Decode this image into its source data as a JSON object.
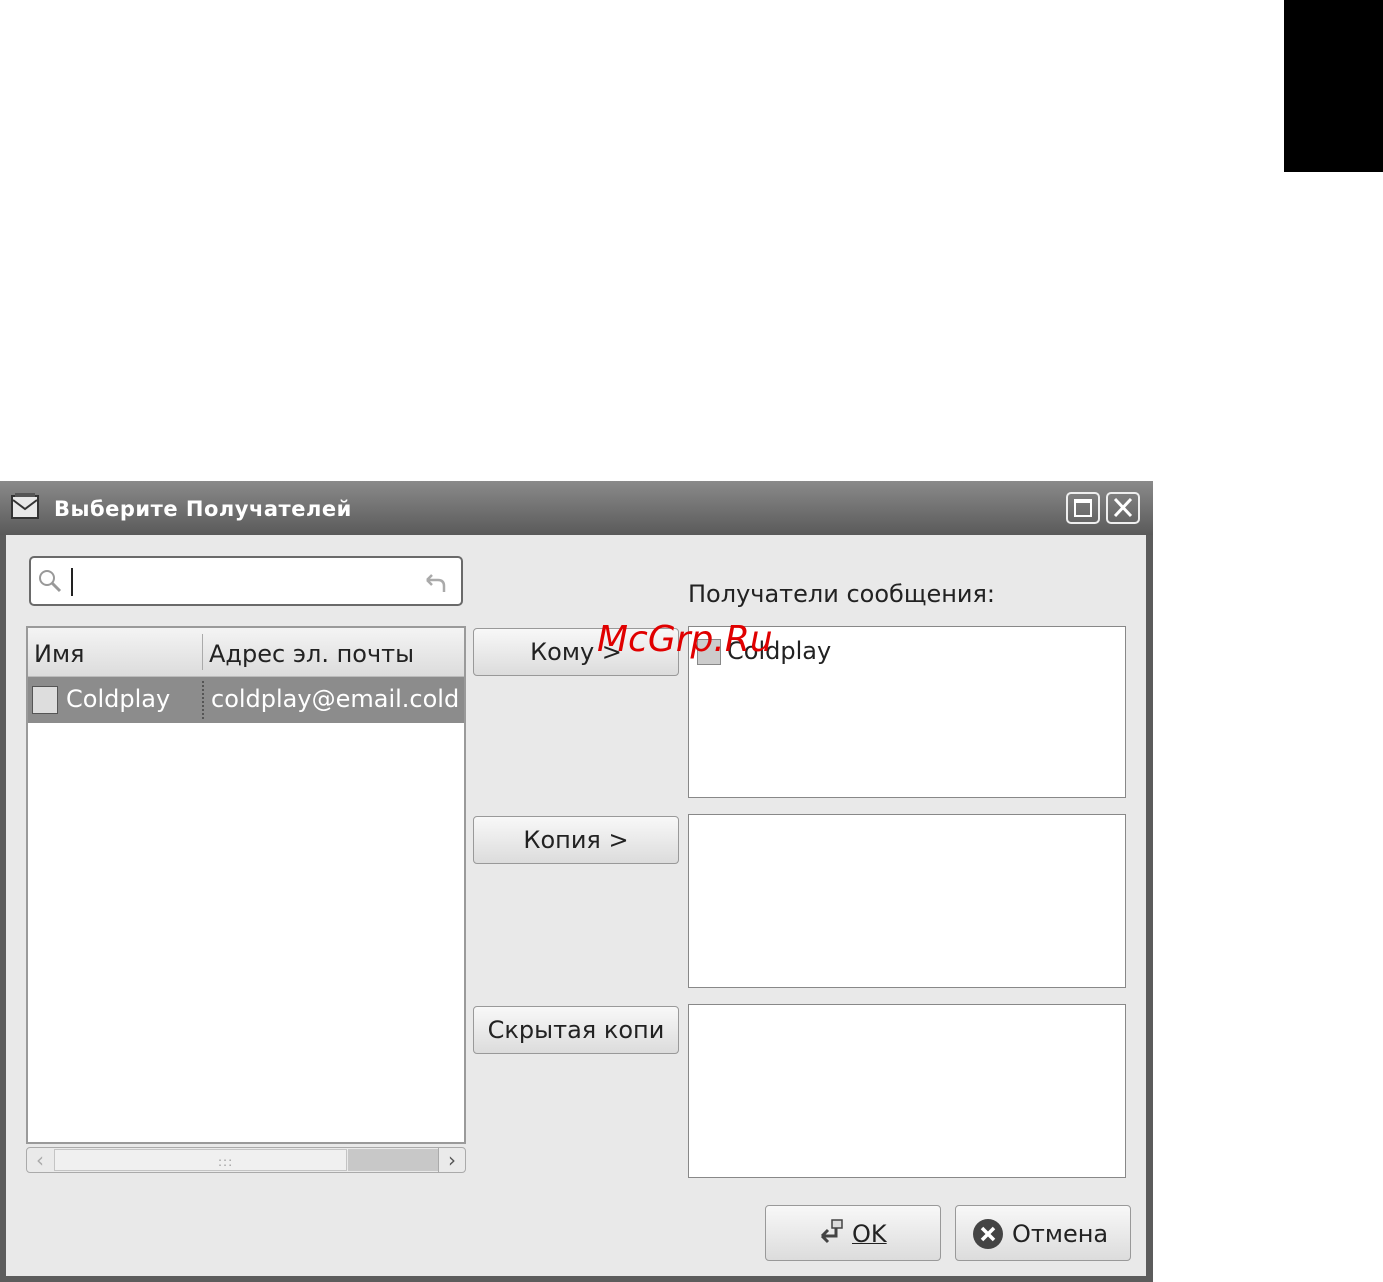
{
  "window": {
    "title": "Выберите Получателей"
  },
  "search": {
    "value": "",
    "placeholder": ""
  },
  "contacts": {
    "headers": [
      "Имя",
      "Адрес эл. почты"
    ],
    "rows": [
      {
        "name": "Coldplay",
        "email": "coldplay@email.cold"
      }
    ]
  },
  "buttons": {
    "to": "Кому >",
    "cc": "Копия >",
    "bcc": "Скрытая копи"
  },
  "recipients": {
    "label": "Получатели сообщения:",
    "to": [
      "Coldplay"
    ],
    "cc": [],
    "bcc": []
  },
  "dialog": {
    "ok": "OK",
    "cancel": "Отмена"
  },
  "watermark": "McGrp.Ru",
  "colors": {
    "titlebar": "#6e6e6e",
    "selected_row": "#8c8c8c",
    "background": "#e9e9e9",
    "watermark": "#e00000"
  },
  "icons": [
    "mail-icon",
    "maximize-icon",
    "close-icon",
    "search-icon",
    "clear-icon",
    "contact-avatar-icon",
    "ok-icon",
    "cancel-icon"
  ]
}
